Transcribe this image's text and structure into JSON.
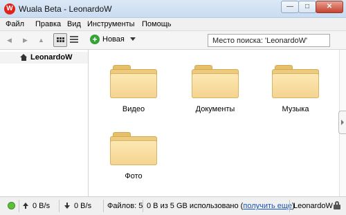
{
  "window": {
    "title": "Wuala Beta - LeonardoW",
    "logo_letter": "W",
    "minimize_glyph": "—",
    "maximize_glyph": "□",
    "close_glyph": "✕"
  },
  "menu": {
    "items": [
      "Файл",
      "Правка",
      "Вид",
      "Инструменты",
      "Помощь"
    ]
  },
  "toolbar": {
    "back_icon": "◀",
    "forward_icon": "▶",
    "up_icon": "▲",
    "new_label": "Новая",
    "search_value": "Место поиска: 'LeonardoW'"
  },
  "sidebar": {
    "root_label": "LeonardoW"
  },
  "folders": [
    {
      "label": "Видео"
    },
    {
      "label": "Документы"
    },
    {
      "label": "Музыка"
    },
    {
      "label": "Фото"
    }
  ],
  "status": {
    "upload_speed": "0 B/s",
    "download_speed": "0 B/s",
    "files_count": "Файлов: 5",
    "usage_text": "0 B из 5 GB использовано (",
    "get_more_link": "получить еще",
    "usage_close": ")",
    "user": "LeonardoW",
    "connection_color": "#5bbf39"
  }
}
